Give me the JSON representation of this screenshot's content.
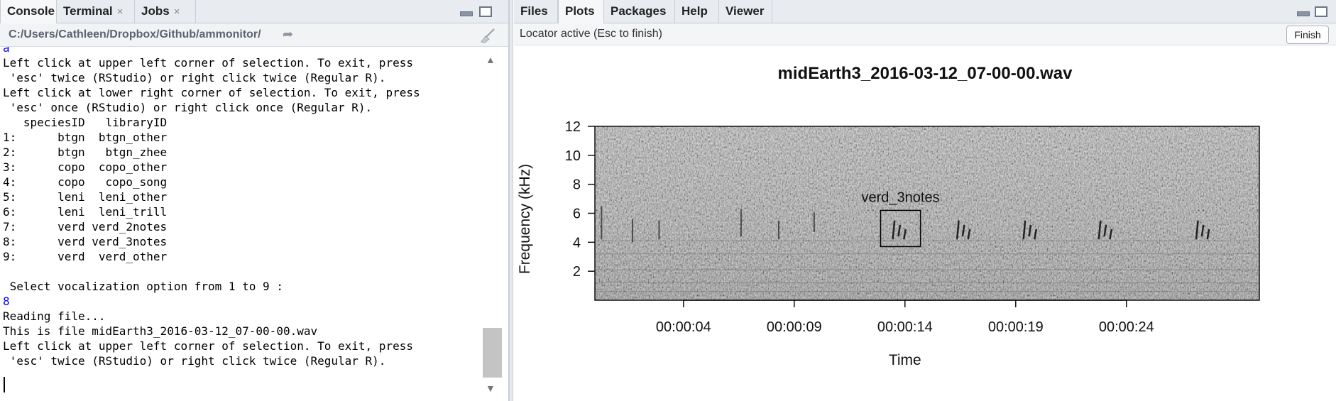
{
  "left": {
    "tabs": [
      {
        "label": "Console",
        "closable": false
      },
      {
        "label": "Terminal",
        "closable": true
      },
      {
        "label": "Jobs",
        "closable": true
      }
    ],
    "close_glyph": "×",
    "path": "C:/Users/Cathleen/Dropbox/Github/ammonitor/",
    "console_lines": [
      {
        "text": "a",
        "color": "blue"
      },
      {
        "text": "Left click at upper left corner of selection. To exit, press",
        "color": "black"
      },
      {
        "text": " 'esc' twice (RStudio) or right click twice (Regular R).",
        "color": "black"
      },
      {
        "text": "Left click at lower right corner of selection. To exit, press",
        "color": "black"
      },
      {
        "text": " 'esc' once (RStudio) or right click once (Regular R).",
        "color": "black"
      },
      {
        "text": "   speciesID   libraryID",
        "color": "black"
      },
      {
        "text": "1:      btgn  btgn_other",
        "color": "black"
      },
      {
        "text": "2:      btgn   btgn_zhee",
        "color": "black"
      },
      {
        "text": "3:      copo  copo_other",
        "color": "black"
      },
      {
        "text": "4:      copo   copo_song",
        "color": "black"
      },
      {
        "text": "5:      leni  leni_other",
        "color": "black"
      },
      {
        "text": "6:      leni  leni_trill",
        "color": "black"
      },
      {
        "text": "7:      verd verd_2notes",
        "color": "black"
      },
      {
        "text": "8:      verd verd_3notes",
        "color": "black"
      },
      {
        "text": "9:      verd  verd_other",
        "color": "black"
      },
      {
        "text": "",
        "color": "black"
      },
      {
        "text": " Select vocalization option from 1 to 9 :",
        "color": "black"
      },
      {
        "text": "8",
        "color": "blue"
      },
      {
        "text": "Reading file...",
        "color": "black"
      },
      {
        "text": "This is file midEarth3_2016-03-12_07-00-00.wav",
        "color": "black"
      },
      {
        "text": "Left click at upper left corner of selection. To exit, press",
        "color": "black"
      },
      {
        "text": " 'esc' twice (RStudio) or right click twice (Regular R).",
        "color": "black"
      }
    ]
  },
  "right": {
    "tabs": [
      "Files",
      "Plots",
      "Packages",
      "Help",
      "Viewer"
    ],
    "active_tab": "Plots",
    "locator_status": "Locator active (Esc to finish)",
    "finish_label": "Finish"
  },
  "chart_data": {
    "type": "heatmap",
    "subtype": "spectrogram",
    "title": "midEarth3_2016-03-12_07-00-00.wav",
    "xlabel": "Time",
    "ylabel": "Frequency (kHz)",
    "x_ticks": [
      "00:00:04",
      "00:00:09",
      "00:00:14",
      "00:00:19",
      "00:00:24"
    ],
    "y_ticks": [
      2,
      4,
      6,
      8,
      10,
      12
    ],
    "ylim": [
      0,
      12
    ],
    "x_tick_seconds": [
      4,
      9,
      14,
      19,
      24
    ],
    "xlim_seconds": [
      0,
      30
    ],
    "annotation": {
      "label": "verd_3notes",
      "x_start_s": 12.9,
      "x_end_s": 14.7,
      "y_low_khz": 3.7,
      "y_high_khz": 6.2
    },
    "colors": {
      "background": "#9d9d9d",
      "call": "#222222",
      "box": "#000000"
    }
  }
}
